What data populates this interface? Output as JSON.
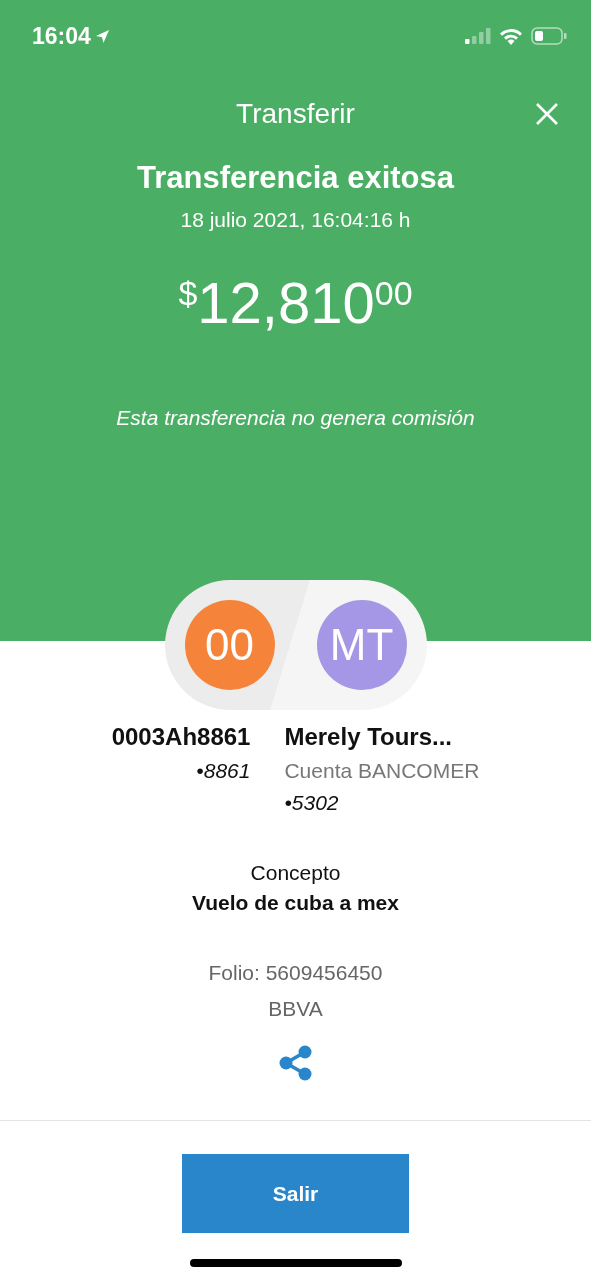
{
  "status_bar": {
    "time": "16:04"
  },
  "header": {
    "title": "Transferir"
  },
  "result": {
    "title": "Transferencia exitosa",
    "date": "18 julio 2021, 16:04:16 h",
    "amount": {
      "currency": "$",
      "whole": "12,810",
      "cents": "00"
    },
    "note": "Esta transferencia no genera comisión"
  },
  "accounts": [
    {
      "initials": "00",
      "color": "#f5843a",
      "name": "0003Ah8861",
      "lines": [
        {
          "kind": "number",
          "text": "•8861"
        }
      ]
    },
    {
      "initials": "MT",
      "color": "#a597e6",
      "name": "Merely Tours...",
      "lines": [
        {
          "kind": "bank",
          "text": "Cuenta BANCOMER"
        },
        {
          "kind": "number",
          "text": "•5302"
        }
      ]
    }
  ],
  "concept": {
    "label": "Concepto",
    "value": "Vuelo de cuba a mex"
  },
  "folio": {
    "number": "Folio: 5609456450",
    "bank": "BBVA"
  },
  "footer": {
    "button": "Salir"
  }
}
